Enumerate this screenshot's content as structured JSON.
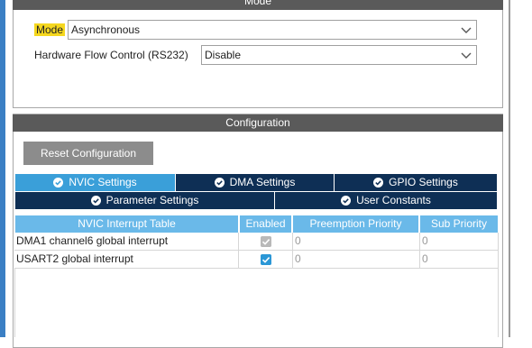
{
  "mode_panel": {
    "header": "Mode",
    "mode_label": "Mode",
    "mode_value": "Asynchronous",
    "flow_label": "Hardware Flow Control (RS232)",
    "flow_value": "Disable"
  },
  "config_panel": {
    "header": "Configuration",
    "reset_label": "Reset Configuration",
    "tabs_row1": [
      "NVIC Settings",
      "DMA Settings",
      "GPIO Settings"
    ],
    "tabs_row2": [
      "Parameter Settings",
      "User Constants"
    ],
    "active_tab": "NVIC Settings"
  },
  "nvic_table": {
    "headers": [
      "NVIC Interrupt Table",
      "Enabled",
      "Preemption Priority",
      "Sub Priority"
    ],
    "rows": [
      {
        "name": "DMA1 channel6 global interrupt",
        "enabled": true,
        "locked": true,
        "preemption": "0",
        "sub": "0"
      },
      {
        "name": "USART2 global interrupt",
        "enabled": true,
        "locked": false,
        "preemption": "0",
        "sub": "0"
      }
    ]
  },
  "colors": {
    "panel_header": "#5a5a5a",
    "tab_dark": "#0e2f55",
    "tab_active": "#3a9fd9",
    "table_header": "#6ab9e9",
    "mode_highlight": "#f5d71e",
    "checkbox_enabled": "#2b97d6",
    "checkbox_disabled": "#b9b9b9"
  },
  "icons": {
    "select_arrow": "chevron-down-icon",
    "tab_icon": "check-circle-icon",
    "checkbox": "checkmark-icon"
  }
}
